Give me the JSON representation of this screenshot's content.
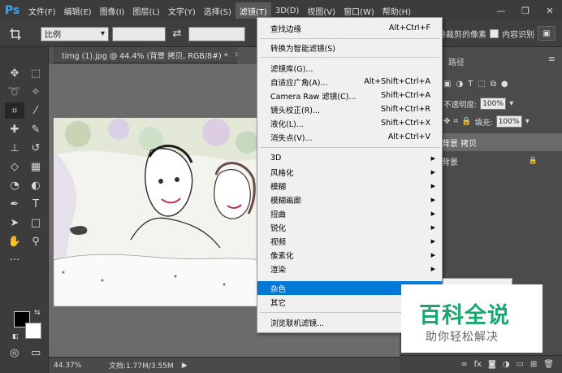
{
  "app": {
    "logo": "Ps"
  },
  "menubar": {
    "items": [
      "文件(F)",
      "编辑(E)",
      "图像(I)",
      "图层(L)",
      "文字(Y)",
      "选择(S)",
      "滤镜(T)",
      "3D(D)",
      "视图(V)",
      "窗口(W)",
      "帮助(H)"
    ],
    "active_index": 6
  },
  "window_controls": {
    "minimize": "—",
    "restore": "❐",
    "close": "✕"
  },
  "options": {
    "ratio_label": "比例",
    "delete_pixels_label": "删除裁剪的像素",
    "content_aware_label": "内容识别"
  },
  "document": {
    "tab_title": "timg (1).jpg @ 44.4% (背景 拷贝, RGB/8#) *",
    "close": "×"
  },
  "status": {
    "zoom": "44.37%",
    "doc_info": "文档:1.77M/3.55M",
    "arrow": "▶"
  },
  "panel": {
    "tab_paths": "路径",
    "opacity_label": "不透明度:",
    "opacity_value": "100%",
    "fill_label": "填充:",
    "fill_value": "100%",
    "layers": [
      {
        "name": "背景 拷贝"
      },
      {
        "name": "背景"
      }
    ]
  },
  "filter_menu": {
    "items": [
      {
        "label": "查找边缘",
        "shortcut": "Alt+Ctrl+F"
      },
      {
        "label": "转换为智能滤镜(S)",
        "shortcut": ""
      },
      {
        "label": "滤镜库(G)...",
        "shortcut": ""
      },
      {
        "label": "自适应广角(A)...",
        "shortcut": "Alt+Shift+Ctrl+A"
      },
      {
        "label": "Camera Raw 滤镜(C)...",
        "shortcut": "Shift+Ctrl+A"
      },
      {
        "label": "镜头校正(R)...",
        "shortcut": "Shift+Ctrl+R"
      },
      {
        "label": "液化(L)...",
        "shortcut": "Shift+Ctrl+X"
      },
      {
        "label": "消失点(V)...",
        "shortcut": "Alt+Ctrl+V"
      },
      {
        "label": "3D",
        "submenu": true
      },
      {
        "label": "风格化",
        "submenu": true
      },
      {
        "label": "模糊",
        "submenu": true
      },
      {
        "label": "模糊画廊",
        "submenu": true
      },
      {
        "label": "扭曲",
        "submenu": true
      },
      {
        "label": "锐化",
        "submenu": true
      },
      {
        "label": "视频",
        "submenu": true
      },
      {
        "label": "像素化",
        "submenu": true
      },
      {
        "label": "渲染",
        "submenu": true
      },
      {
        "label": "杂色",
        "submenu": true,
        "highlighted": true
      },
      {
        "label": "其它",
        "submenu": true
      },
      {
        "label": "浏览联机滤镜...",
        "shortcut": ""
      }
    ]
  },
  "watermark": {
    "title": "百科全说",
    "subtitle": "助你轻松解决"
  },
  "colors": {
    "accent": "#0078d7",
    "ps_blue": "#31a8ff",
    "watermark_green": "#1aa76f"
  }
}
